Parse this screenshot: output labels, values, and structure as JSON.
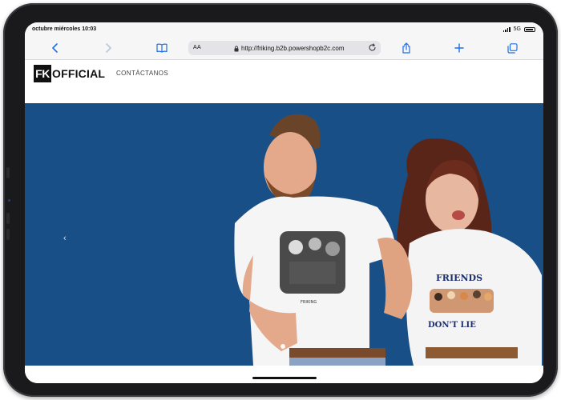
{
  "status_bar": {
    "time": "octubre miércoles 10:03",
    "network": "5G"
  },
  "browser": {
    "text_size_label": "AA",
    "url": "http://friking.b2b.powershopb2c.com",
    "icons": [
      "chevron-left-icon",
      "chevron-right-icon",
      "book-icon",
      "lock-icon",
      "reload-icon",
      "share-icon",
      "plus-icon",
      "tabs-icon"
    ]
  },
  "site": {
    "logo_box": "FK",
    "logo_text": "OFFICIAL",
    "nav": {
      "contact_label": "CONTÁCTANOS"
    }
  },
  "hero": {
    "prev_arrow": "‹",
    "shirt_left_caption": "FRIKING",
    "shirt_right_line1": "FRIENDS",
    "shirt_right_line2": "DON'T LIE",
    "background_color": "#184f86",
    "active_slide": 1,
    "slide_count": 1
  }
}
